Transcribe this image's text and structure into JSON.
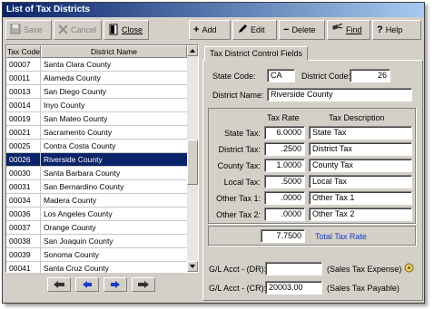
{
  "window": {
    "title": "List of Tax Districts"
  },
  "toolbar": {
    "save": "Save",
    "cancel": "Cancel",
    "close": "Close",
    "add": "Add",
    "edit": "Edit",
    "delete": "Delete",
    "find": "Find",
    "help": "Help"
  },
  "grid": {
    "headers": {
      "code": "Tax Code",
      "name": "District Name"
    },
    "rows": [
      {
        "code": "00007",
        "name": "Santa Clara County"
      },
      {
        "code": "00011",
        "name": "Alameda County"
      },
      {
        "code": "00013",
        "name": "San Diego County"
      },
      {
        "code": "00014",
        "name": "Inyo County"
      },
      {
        "code": "00019",
        "name": "San Mateo County"
      },
      {
        "code": "00021",
        "name": "Sacramento County"
      },
      {
        "code": "00025",
        "name": "Contra Costa County"
      },
      {
        "code": "00026",
        "name": "Riverside County"
      },
      {
        "code": "00030",
        "name": "Santa Barbara County"
      },
      {
        "code": "00031",
        "name": "San Bernardino County"
      },
      {
        "code": "00034",
        "name": "Madera County"
      },
      {
        "code": "00036",
        "name": "Los Angeles County"
      },
      {
        "code": "00037",
        "name": "Orange County"
      },
      {
        "code": "00038",
        "name": "San Joaquin County"
      },
      {
        "code": "00039",
        "name": "Sonoma County"
      },
      {
        "code": "00041",
        "name": "Santa Cruz County"
      }
    ],
    "selected_code": "00026"
  },
  "panel": {
    "tab_label": "Tax District Control Fields",
    "state_code_label": "State Code:",
    "state_code_value": "CA",
    "district_code_label": "District Code:",
    "district_code_value": "26",
    "district_name_label": "District Name:",
    "district_name_value": "Riverside County",
    "col_rate": "Tax Rate",
    "col_desc": "Tax Description",
    "taxes": [
      {
        "label": "State Tax:",
        "rate": "6.0000",
        "desc": "State Tax"
      },
      {
        "label": "District Tax:",
        "rate": ".2500",
        "desc": "District Tax"
      },
      {
        "label": "County Tax:",
        "rate": "1.0000",
        "desc": "County Tax"
      },
      {
        "label": "Local Tax:",
        "rate": ".5000",
        "desc": "Local Tax"
      },
      {
        "label": "Other Tax 1:",
        "rate": ".0000",
        "desc": "Other Tax 1"
      },
      {
        "label": "Other Tax 2:",
        "rate": ".0000",
        "desc": "Other Tax 2"
      }
    ],
    "total_rate_value": "7.7500",
    "total_rate_label": "Total Tax Rate",
    "gl_dr_label": "G/L Acct - (DR):",
    "gl_dr_value": "",
    "gl_dr_desc": "(Sales Tax Expense)",
    "gl_cr_label": "G/L Acct - (CR):",
    "gl_cr_value": "20003.00",
    "gl_cr_desc": "(Sales Tax Payable)"
  },
  "colors": {
    "selection": "#0a246a",
    "title_start": "#0a246a",
    "accent_link": "#1a3cc8"
  }
}
